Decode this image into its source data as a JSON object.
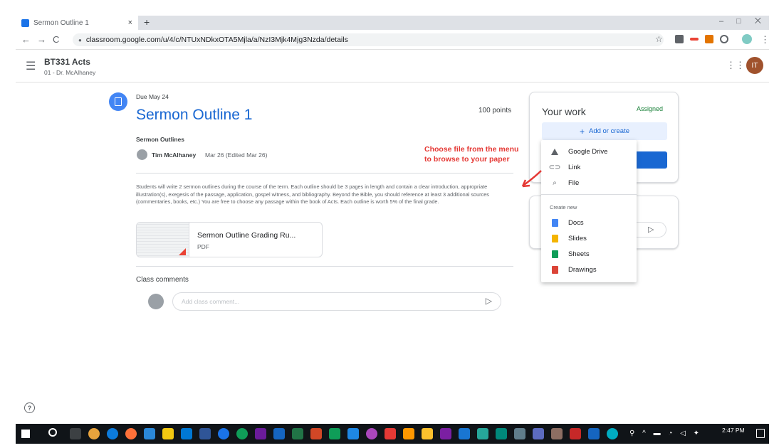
{
  "browser": {
    "tab_title": "Sermon Outline 1",
    "tab_close": "×",
    "new_tab": "+",
    "url": "classroom.google.com/u/4/c/NTUxNDkxOTA5Mjla/a/NzI3Mjk4Mjg3Nzda/details",
    "back": "←",
    "forward": "→",
    "reload": "C",
    "minimize": "–",
    "restore": "□",
    "close_window": "⨉"
  },
  "header": {
    "course_title": "BT331 Acts",
    "course_subtitle": "01 - Dr. McAlhaney",
    "avatar_initials": "IT"
  },
  "assignment": {
    "due": "Due May 24",
    "title": "Sermon Outline 1",
    "points": "100 points",
    "topic": "Sermon Outlines",
    "author": "Tim McAlhaney",
    "date": "Mar 26 (Edited Mar 26)",
    "description": "Students will write 2 sermon outlines during the course of the term. Each outline should be 3 pages in length and contain a clear introduction, appropriate illustration(s), exegesis of the passage, application, gospel witness, and bibliography. Beyond the Bible, you should reference at least 3 additional sources (commentaries, books, etc.) You are free to choose any passage within the book of Acts. Each outline is worth 5% of the final grade.",
    "attachment": {
      "name": "Sermon Outline Grading Ru...",
      "type": "PDF"
    }
  },
  "comments": {
    "label": "Class comments",
    "placeholder": "Add class comment..."
  },
  "your_work": {
    "title": "Your work",
    "status": "Assigned",
    "add_label": "Add or create",
    "status_color": "#188038"
  },
  "menu": {
    "items": [
      {
        "label": "Google Drive",
        "icon": "drive-icon"
      },
      {
        "label": "Link",
        "icon": "link-icon"
      },
      {
        "label": "File",
        "icon": "paperclip-icon"
      }
    ],
    "create_new_label": "Create new",
    "create_items": [
      {
        "label": "Docs",
        "icon": "docs-icon",
        "color": "#4285f4"
      },
      {
        "label": "Slides",
        "icon": "slides-icon",
        "color": "#f4b400"
      },
      {
        "label": "Sheets",
        "icon": "sheets-icon",
        "color": "#0f9d58"
      },
      {
        "label": "Drawings",
        "icon": "drawings-icon",
        "color": "#db4437"
      }
    ]
  },
  "annotation": {
    "text": "Choose file from the menu to browse to your paper",
    "color": "#e53935"
  },
  "taskbar": {
    "time": "2:47 PM"
  }
}
